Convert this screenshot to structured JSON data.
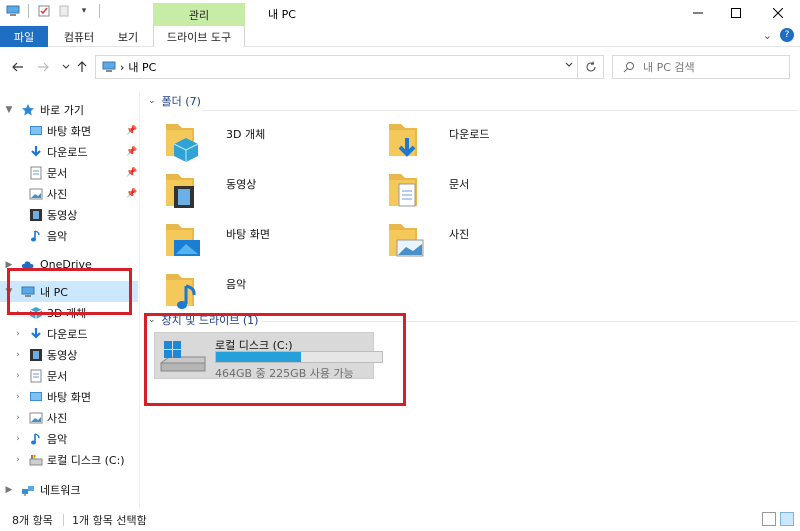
{
  "window": {
    "title": "내 PC",
    "context_group": "관리",
    "minimize": "—",
    "maximize": "☐",
    "close": "✕"
  },
  "ribbon": {
    "tabs": [
      {
        "label": "파일"
      },
      {
        "label": "컴퓨터"
      },
      {
        "label": "보기"
      },
      {
        "label": "드라이브 도구"
      }
    ],
    "collapse": "⌄",
    "help": "?"
  },
  "address": {
    "path": "내 PC",
    "separator": "›",
    "search_placeholder": "내 PC 검색"
  },
  "nav": {
    "quick_access": "바로 가기",
    "quick_items": [
      {
        "label": "바탕 화면",
        "pinned": true
      },
      {
        "label": "다운로드",
        "pinned": true
      },
      {
        "label": "문서",
        "pinned": true
      },
      {
        "label": "사진",
        "pinned": true
      },
      {
        "label": "동영상",
        "pinned": false
      },
      {
        "label": "음악",
        "pinned": false
      }
    ],
    "onedrive": "OneDrive",
    "this_pc": "내 PC",
    "pc_items": [
      {
        "label": "3D 개체"
      },
      {
        "label": "다운로드"
      },
      {
        "label": "동영상"
      },
      {
        "label": "문서"
      },
      {
        "label": "바탕 화면"
      },
      {
        "label": "사진"
      },
      {
        "label": "음악"
      },
      {
        "label": "로컬 디스크 (C:)"
      }
    ],
    "network": "네트워크"
  },
  "main": {
    "folders_header": "폴더 (7)",
    "folders": [
      {
        "label": "3D 개체"
      },
      {
        "label": "다운로드"
      },
      {
        "label": "동영상"
      },
      {
        "label": "문서"
      },
      {
        "label": "바탕 화면"
      },
      {
        "label": "사진"
      },
      {
        "label": "음악"
      }
    ],
    "drives_header": "장치 및 드라이브 (1)",
    "drive": {
      "name": "로컬 디스크 (C:)",
      "capacity": "464GB 중 225GB 사용 가능",
      "used_fraction": 0.515
    }
  },
  "status": {
    "items": "8개 항목",
    "selected": "1개 항목 선택함"
  },
  "colors": {
    "accent": "#1e6fc4",
    "context_tab": "#c7eca5",
    "selection": "#cce8ff",
    "highlight": "#d71f2a",
    "folder": "#f5c85a",
    "drive_fill": "#26a0da"
  }
}
